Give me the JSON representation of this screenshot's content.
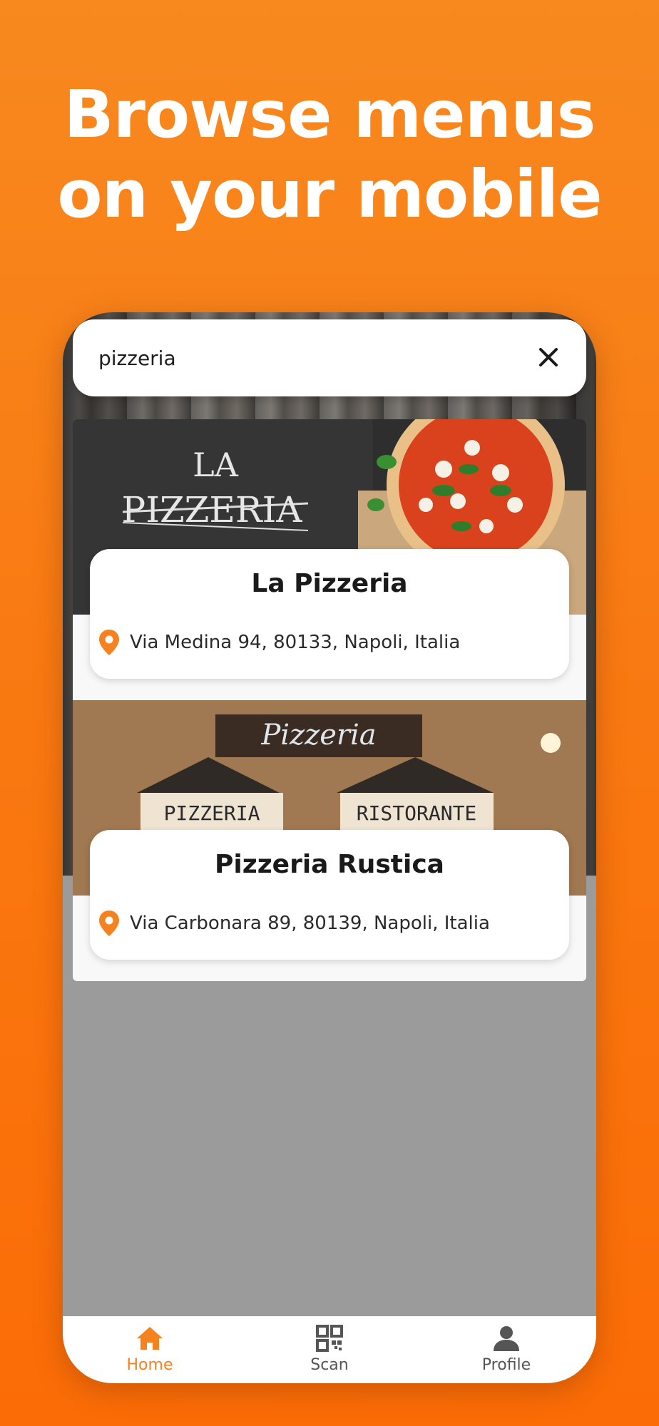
{
  "headline": {
    "line1": "Browse menus",
    "line2": "on your mobile"
  },
  "search": {
    "value": "pizzeria",
    "clear_icon": "close-icon"
  },
  "results": [
    {
      "name": "La Pizzeria",
      "image_text_1": "LA",
      "image_text_2": "PIZZERIA",
      "address": "Via Medina 94, 80133, Napoli, Italia",
      "icon": "location-pin-icon"
    },
    {
      "name": "Pizzeria Rustica",
      "image_text_1": "Pizzeria",
      "image_text_2": "PIZZERIA",
      "image_text_3": "RISTORANTE",
      "address": "Via Carbonara 89, 80139, Napoli, Italia",
      "icon": "location-pin-icon"
    }
  ],
  "nav": {
    "items": [
      {
        "label": "Home",
        "icon": "home-icon",
        "active": true
      },
      {
        "label": "Scan",
        "icon": "qr-code-icon",
        "active": false
      },
      {
        "label": "Profile",
        "icon": "user-icon",
        "active": false
      }
    ]
  },
  "colors": {
    "accent": "#f5821f",
    "background": "#f97a12",
    "inactive": "#555555"
  }
}
